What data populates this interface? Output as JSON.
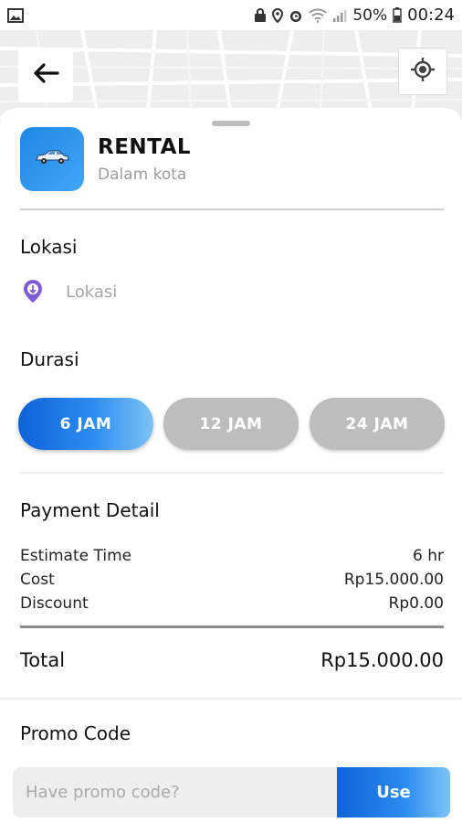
{
  "status_bar": {
    "battery_percent": "50%",
    "time": "00:24"
  },
  "service": {
    "title": "RENTAL",
    "subtitle": "Dalam kota",
    "icon": "car-icon"
  },
  "location": {
    "section_label": "Lokasi",
    "placeholder": "Lokasi",
    "icon": "location-pin-icon"
  },
  "duration": {
    "section_label": "Durasi",
    "options": [
      {
        "label": "6 JAM",
        "selected": true
      },
      {
        "label": "12 JAM",
        "selected": false
      },
      {
        "label": "24 JAM",
        "selected": false
      }
    ]
  },
  "payment": {
    "section_label": "Payment Detail",
    "rows": [
      {
        "label": "Estimate Time",
        "value": "6 hr"
      },
      {
        "label": "Cost",
        "value": "Rp15.000.00"
      },
      {
        "label": "Discount",
        "value": "Rp0.00"
      }
    ],
    "total_label": "Total",
    "total_value": "Rp15.000.00"
  },
  "promo": {
    "section_label": "Promo Code",
    "placeholder": "Have promo code?",
    "button_label": "Use"
  },
  "colors": {
    "accent": "#1e88e5",
    "inactive": "#bdbdbd"
  }
}
